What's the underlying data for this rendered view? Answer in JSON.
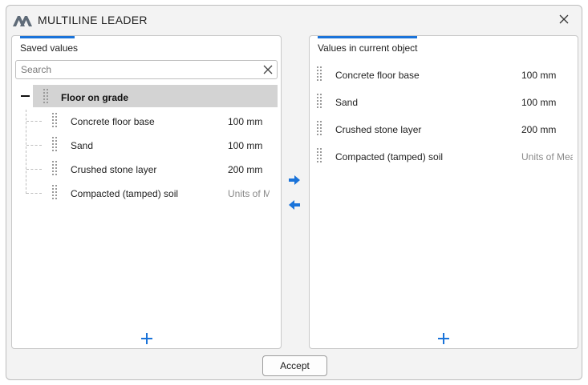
{
  "window": {
    "title": "MULTILINE LEADER"
  },
  "left_panel": {
    "title": "Saved values",
    "search": {
      "placeholder": "Search",
      "value": ""
    },
    "group": {
      "label": "Floor on grade",
      "expanded": true,
      "items": [
        {
          "name": "Concrete floor base",
          "value": "100 mm"
        },
        {
          "name": "Sand",
          "value": "100 mm"
        },
        {
          "name": "Crushed stone layer",
          "value": "200 mm"
        },
        {
          "name": "Compacted (tamped) soil",
          "value": "Units of M"
        }
      ]
    }
  },
  "right_panel": {
    "title": "Values in current object",
    "items": [
      {
        "name": "Concrete floor base",
        "value": "100 mm"
      },
      {
        "name": "Sand",
        "value": "100 mm"
      },
      {
        "name": "Crushed stone layer",
        "value": "200 mm"
      },
      {
        "name": "Compacted (tamped) soil",
        "value": "Units of Mea"
      }
    ]
  },
  "actions": {
    "accept_label": "Accept"
  },
  "colors": {
    "accent": "#1a73d9",
    "selected_row": "#d3d3d3",
    "window_bg": "#f3f3f3"
  },
  "icons": {
    "logo": "app-logo-icon",
    "close": "close-icon",
    "clear": "clear-search-icon",
    "move_right": "arrow-right-icon",
    "move_left": "arrow-left-icon",
    "add": "plus-icon",
    "drag": "drag-handle-icon"
  }
}
